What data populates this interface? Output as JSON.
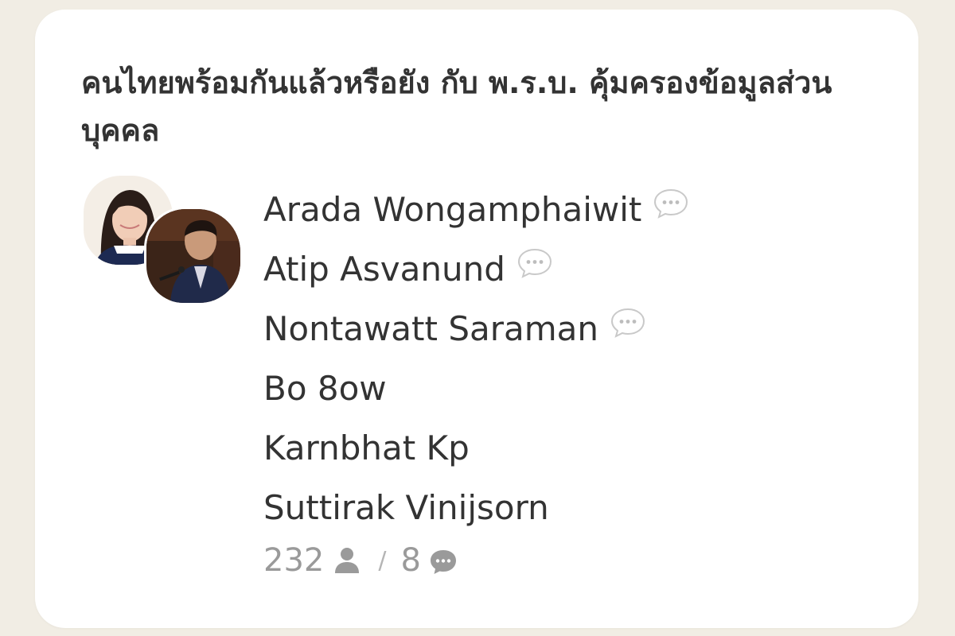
{
  "room": {
    "title": "คนไทยพร้อมกันแล้วหรือยัง กับ พ.ร.บ. คุ้มครองข้อมูลส่วนบุคคล"
  },
  "speakers": [
    {
      "name": "Arada Wongamphaiwit",
      "icon": "speech-bubble-icon"
    },
    {
      "name": "Atip Asvanund",
      "icon": "speech-bubble-icon"
    },
    {
      "name": "Nontawatt Saraman",
      "icon": "speech-bubble-icon"
    },
    {
      "name": "Bo 8ow"
    },
    {
      "name": "Karnbhat Kp"
    },
    {
      "name": "Suttirak Vinijsorn"
    }
  ],
  "stats": {
    "listeners": "232",
    "listeners_icon": "person-icon",
    "separator": "/",
    "speakers": "8",
    "speakers_icon": "chat-bubble-icon"
  },
  "colors": {
    "background": "#f1ede4",
    "card": "#ffffff",
    "text": "#333333",
    "muted": "#9a9a9a"
  }
}
